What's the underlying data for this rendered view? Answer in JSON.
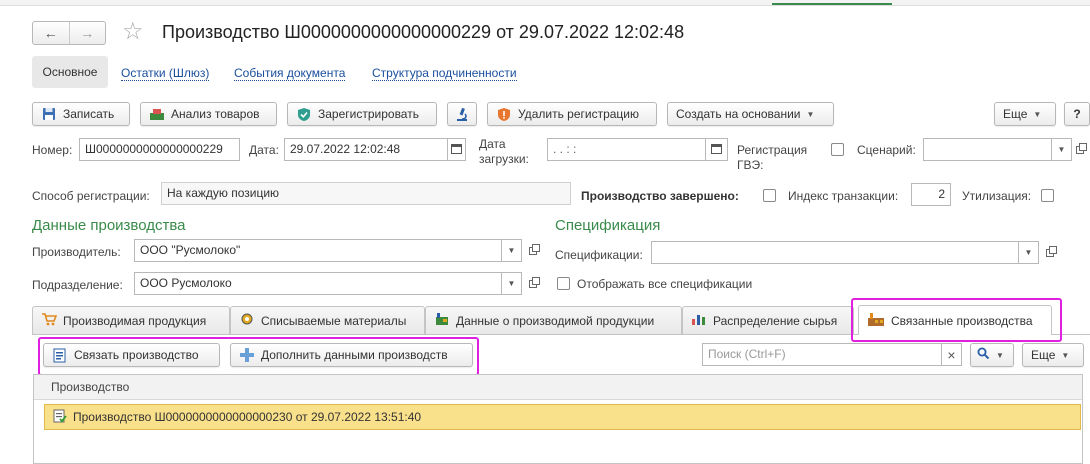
{
  "header": {
    "title": "Производство Ш0000000000000000229 от 29.07.2022 12:02:48",
    "back_glyph": "🡐",
    "forward_glyph": "🡒",
    "star_glyph": "☆"
  },
  "nav_tabs": [
    {
      "label": "Основное"
    },
    {
      "label": "Остатки (Шлюз)"
    },
    {
      "label": "События документа"
    },
    {
      "label": "Структура подчиненности"
    }
  ],
  "toolbar": {
    "save_label": "Записать",
    "analysis_label": "Анализ товаров",
    "register_label": "Зарегистрировать",
    "delete_reg_label": "Удалить регистрацию",
    "create_based_label": "Создать на основании",
    "more_label": "Еще",
    "help_label": "?"
  },
  "fields": {
    "number_label": "Номер:",
    "number_value": "Ш0000000000000000229",
    "date_label": "Дата:",
    "date_value": "29.07.2022 12:02:48",
    "load_date_label_1": "Дата",
    "load_date_label_2": "загрузки:",
    "load_date_value": ".   .          :   :",
    "gve_label_1": "Регистрация",
    "gve_label_2": "ГВЭ:",
    "scenario_label": "Сценарий:",
    "scenario_value": "",
    "reg_method_label": "Способ регистрации:",
    "reg_method_value": "На каждую позицию",
    "production_done_label": "Производство завершено:",
    "transaction_index_label": "Индекс транзакции:",
    "transaction_index_value": "2",
    "utilization_label": "Утилизация:"
  },
  "production_data": {
    "section_title": "Данные производства",
    "manufacturer_label": "Производитель:",
    "manufacturer_value": "ООО \"Русмолоко\"",
    "division_label": "Подразделение:",
    "division_value": "ООО Русмолоко"
  },
  "specification": {
    "section_title": "Спецификация",
    "spec_label": "Спецификации:",
    "spec_value": "",
    "show_all_label": "Отображать все спецификации"
  },
  "tabs": [
    {
      "label": "Производимая продукция"
    },
    {
      "label": "Списываемые материалы"
    },
    {
      "label": "Данные о производимой продукции"
    },
    {
      "label": "Распределение сырья"
    },
    {
      "label": "Связанные производства"
    }
  ],
  "linked_toolbar": {
    "link_label": "Связать производство",
    "fill_label": "Дополнить данными производств",
    "search_placeholder": "Поиск (Ctrl+F)",
    "clear_glyph": "×",
    "more_label": "Еще"
  },
  "table": {
    "column_header": "Производство",
    "rows": [
      {
        "label": "Производство Ш0000000000000000230 от 29.07.2022 13:51:40"
      }
    ]
  },
  "colors": {
    "accent_green": "#3a8a4a",
    "link_blue": "#1a4e9c",
    "highlight_magenta": "#e020e0",
    "selected_row": "#f9e08a"
  }
}
